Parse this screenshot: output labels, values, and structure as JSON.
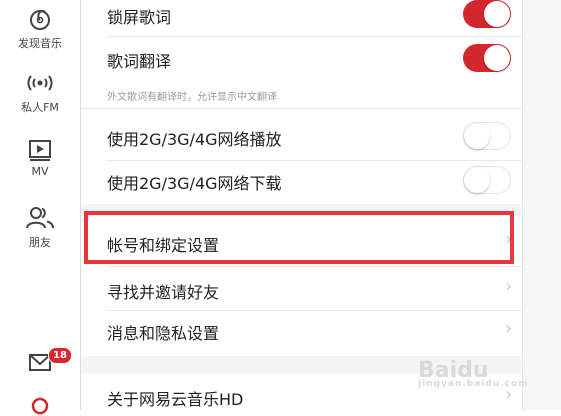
{
  "sidebar": {
    "items": [
      {
        "label": "发现音乐",
        "icon": "netease-music-icon"
      },
      {
        "label": "私人FM",
        "icon": "radio-broadcast-icon"
      },
      {
        "label": "MV",
        "icon": "play-video-icon"
      },
      {
        "label": "朋友",
        "icon": "friends-icon"
      }
    ],
    "messages_badge": "18",
    "messages_icon": "mail-icon",
    "search_icon": "search-icon"
  },
  "settings": {
    "lock_screen_lyrics": {
      "label": "锁屏歌词",
      "enabled": true
    },
    "lyrics_translation": {
      "label": "歌词翻译",
      "enabled": true
    },
    "translation_hint": "外文歌词有翻译时，允许显示中文翻译",
    "play_on_cellular": {
      "label": "使用2G/3G/4G网络播放",
      "enabled": false
    },
    "download_on_cellular": {
      "label": "使用2G/3G/4G网络下载",
      "enabled": false
    },
    "account_binding": {
      "label": "帐号和绑定设置"
    },
    "find_invite_friends": {
      "label": "寻找并邀请好友"
    },
    "message_privacy": {
      "label": "消息和隐私设置"
    },
    "about": {
      "label": "关于网易云音乐HD"
    }
  },
  "colors": {
    "accent_red": "#d4262d",
    "highlight_border": "#e8373e"
  },
  "watermark": {
    "text": "Baidu",
    "subtext": "jingyan.baidu.com"
  }
}
